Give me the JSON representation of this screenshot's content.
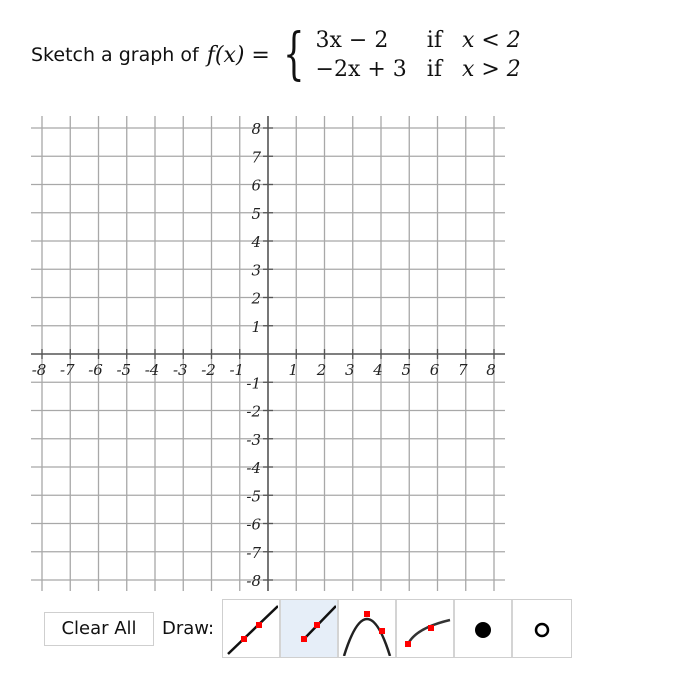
{
  "prompt": {
    "text": "Sketch a graph of",
    "function_lhs": "f(x) =",
    "cases": [
      {
        "expr": "3x − 2",
        "cond_word": "if",
        "cond": "x < 2"
      },
      {
        "expr": "−2x + 3",
        "cond_word": "if",
        "cond": "x > 2"
      }
    ]
  },
  "graph": {
    "x_range": [
      -8,
      8
    ],
    "y_range": [
      -8,
      8
    ],
    "grid_step": 1,
    "x_tick_labels": [
      "-8",
      "-7",
      "-6",
      "-5",
      "-4",
      "-3",
      "-2",
      "-1",
      "1",
      "2",
      "3",
      "4",
      "5",
      "6",
      "7",
      "8"
    ],
    "y_tick_labels": [
      "8",
      "7",
      "6",
      "5",
      "4",
      "3",
      "2",
      "1",
      "-1",
      "-2",
      "-3",
      "-4",
      "-5",
      "-6",
      "-7",
      "-8"
    ],
    "colors": {
      "grid": "#a8a8a8",
      "axis": "#555555",
      "point": "#ff0000"
    }
  },
  "toolbar": {
    "clear_label": "Clear All",
    "draw_label": "Draw:",
    "tools": [
      {
        "name": "line",
        "icon": "line-tool-icon",
        "active": false
      },
      {
        "name": "ray",
        "icon": "ray-tool-icon",
        "active": true
      },
      {
        "name": "parabola",
        "icon": "parabola-tool-icon",
        "active": false
      },
      {
        "name": "curve",
        "icon": "curve-tool-icon",
        "active": false
      },
      {
        "name": "closed-point",
        "icon": "closed-point-icon",
        "active": false
      },
      {
        "name": "open-point",
        "icon": "open-point-icon",
        "active": false
      }
    ]
  }
}
